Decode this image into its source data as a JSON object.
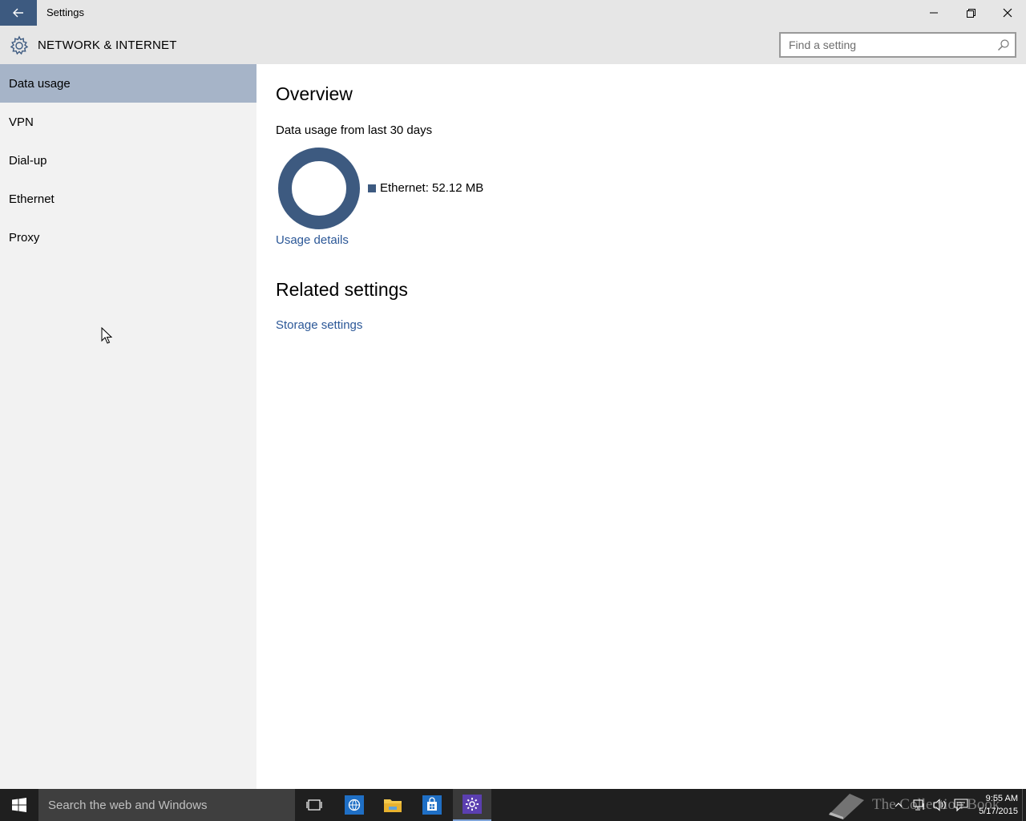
{
  "window": {
    "title": "Settings",
    "minimize_icon": "minimize-icon",
    "restore_icon": "restore-icon",
    "close_icon": "close-icon"
  },
  "header": {
    "title": "NETWORK & INTERNET",
    "search_placeholder": "Find a setting"
  },
  "sidebar": {
    "items": [
      {
        "label": "Data usage",
        "selected": true
      },
      {
        "label": "VPN"
      },
      {
        "label": "Dial-up"
      },
      {
        "label": "Ethernet"
      },
      {
        "label": "Proxy"
      }
    ]
  },
  "main": {
    "overview_heading": "Overview",
    "usage_caption": "Data usage from last 30 days",
    "legend_label": "Ethernet: 52.12 MB",
    "usage_details_link": "Usage details",
    "related_heading": "Related settings",
    "storage_link": "Storage settings"
  },
  "chart_data": {
    "type": "pie",
    "title": "",
    "series": [
      {
        "name": "Ethernet",
        "value": 52.12,
        "unit": "MB",
        "color": "#3d5a80"
      }
    ]
  },
  "taskbar": {
    "search_text": "Search the web and Windows",
    "watermark": "The Collection Book",
    "time": "9:55 AM",
    "date": "5/17/2015"
  },
  "colors": {
    "accent": "#3d5a80",
    "selected_nav": "#a6b4c8",
    "link": "#2b5797"
  }
}
